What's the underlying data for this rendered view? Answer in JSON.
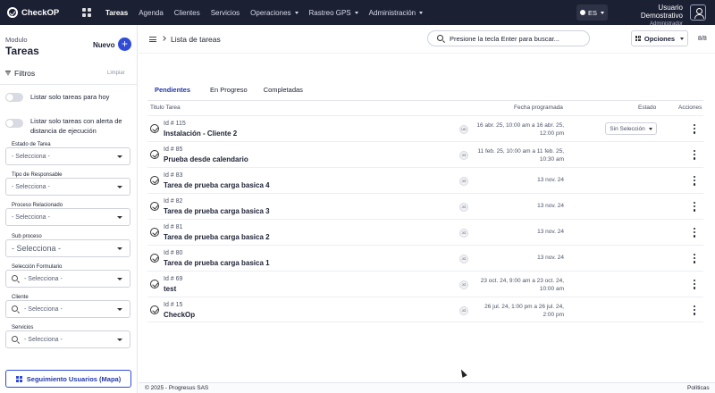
{
  "topbar": {
    "logo": "CheckOP",
    "nav": [
      {
        "label": "Tareas",
        "active": true,
        "dropdown": false
      },
      {
        "label": "Agenda",
        "active": false,
        "dropdown": false
      },
      {
        "label": "Clientes",
        "active": false,
        "dropdown": false
      },
      {
        "label": "Servicios",
        "active": false,
        "dropdown": false
      },
      {
        "label": "Operaciones",
        "active": false,
        "dropdown": true
      },
      {
        "label": "Rastreo GPS",
        "active": false,
        "dropdown": true
      },
      {
        "label": "Administración",
        "active": false,
        "dropdown": true
      }
    ],
    "language": "ES",
    "user_name": "Usuario Demostrativo",
    "user_role": "Administrador"
  },
  "sidebar": {
    "module_label": "Modulo",
    "module_title": "Tareas",
    "new_label": "Nuevo",
    "new_symbol": "+",
    "filters_label": "Filtros",
    "clear_label": "Limpiar",
    "toggles": [
      {
        "label": "Listar solo tareas para hoy",
        "on": false
      },
      {
        "label": "Listar solo tareas con alerta de distancia de ejecución",
        "on": false
      }
    ],
    "fields": [
      {
        "label": "Estado de Tarea",
        "value": "- Selecciona -"
      },
      {
        "label": "Tipo de Responsable",
        "value": "- Selecciona -"
      },
      {
        "label": "Proceso Relacionado",
        "value": "- Selecciona -"
      },
      {
        "label": "Sub proceso",
        "value": "- Selecciona -"
      },
      {
        "label": "Selección Formulario",
        "value": "- Selecciona -"
      },
      {
        "label": "Cliente",
        "value": "- Selecciona -"
      },
      {
        "label": "Servicios",
        "value": "- Selecciona -"
      }
    ],
    "map_button": "Seguimiento Usuarios (Mapa)"
  },
  "header": {
    "breadcrumb": "Lista de tareas",
    "search_placeholder": "Presione la tecla Enter para buscar...",
    "options_label": "Opciones",
    "page_count": "8/8"
  },
  "tabs": [
    {
      "label": "Pendientes",
      "active": true
    },
    {
      "label": "En Progreso",
      "active": false
    },
    {
      "label": "Completadas",
      "active": false
    }
  ],
  "table": {
    "columns": [
      "Titulo Tarea",
      "Fecha programada",
      "Estado",
      "Acciones"
    ],
    "rows": [
      {
        "id": "Id # 115",
        "name": "Instalación - Cliente 2",
        "initials": "UD",
        "date": "16 abr. 25, 10:00 am a 16 abr. 25, 12:00 pm",
        "state": "Sin Selección"
      },
      {
        "id": "Id # 85",
        "name": "Prueba desde calendario",
        "initials": "JG",
        "date": "11 feb. 25, 10:00 am a 11 feb. 25, 10:30 am",
        "state": ""
      },
      {
        "id": "Id # 83",
        "name": "Tarea de prueba carga basica 4",
        "initials": "JG",
        "date": "13 nov. 24",
        "state": ""
      },
      {
        "id": "Id # 82",
        "name": "Tarea de prueba carga basica 3",
        "initials": "JG",
        "date": "13 nov. 24",
        "state": ""
      },
      {
        "id": "Id # 81",
        "name": "Tarea de prueba carga basica 2",
        "initials": "JG",
        "date": "13 nov. 24",
        "state": ""
      },
      {
        "id": "Id # 80",
        "name": "Tarea de prueba carga basica 1",
        "initials": "JG",
        "date": "13 nov. 24",
        "state": ""
      },
      {
        "id": "Id # 69",
        "name": "test",
        "initials": "JG",
        "date": "23 oct. 24, 9:00 am a 23 oct. 24, 10:00 am",
        "state": ""
      },
      {
        "id": "Id # 15",
        "name": "CheckOp",
        "initials": "JG",
        "date": "26 jul. 24, 1:00 pm a 26 jul. 24, 2:00 pm",
        "state": ""
      }
    ]
  },
  "footer": {
    "copyright": "© 2025 - Progresus SAS",
    "policies": "Políticas"
  },
  "colors": {
    "topbar": "#1c2033",
    "accent": "#2f4bd8",
    "active_tab": "#2238a8"
  }
}
